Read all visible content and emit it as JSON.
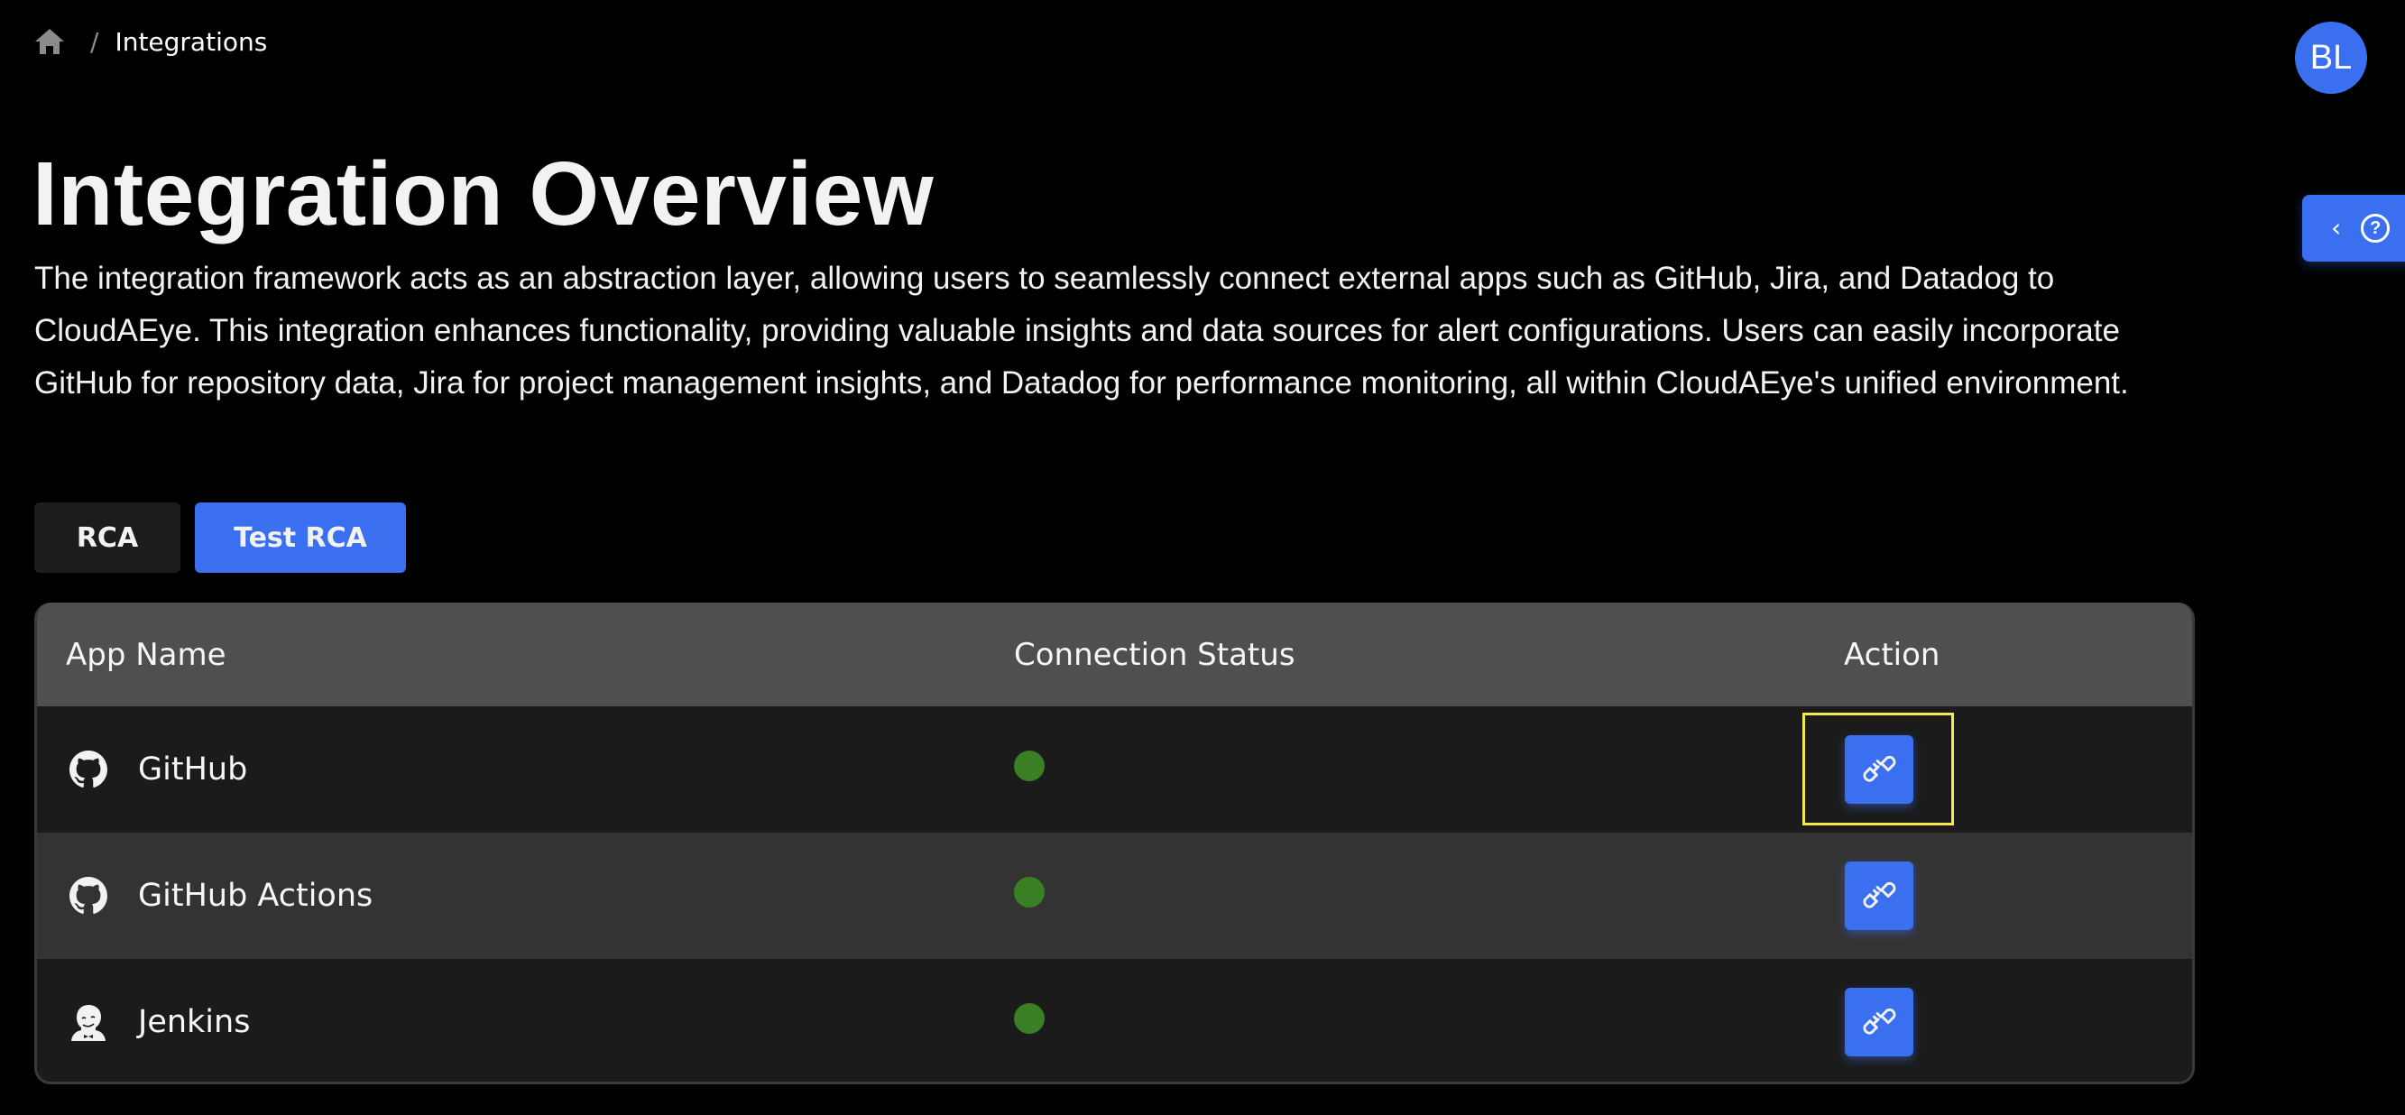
{
  "breadcrumb": {
    "home_icon": "home-icon",
    "separator": "/",
    "current": "Integrations"
  },
  "user": {
    "initials": "BL",
    "avatar_color": "#3a6ff0"
  },
  "help_tab": {
    "collapse_icon": "chevron-left-icon",
    "help_icon": "question-circle-icon",
    "chevron": "‹",
    "help_glyph": "?"
  },
  "page": {
    "title": "Integration Overview",
    "description": "The integration framework acts as an abstraction layer, allowing users to seamlessly connect external apps such as GitHub, Jira, and Datadog to CloudAEye. This integration enhances functionality, providing valuable insights and data sources for alert configurations. Users can easily incorporate GitHub for repository data, Jira for project management insights, and Datadog for performance monitoring, all within CloudAEye's unified environment."
  },
  "tabs": [
    {
      "label": "RCA",
      "active": false
    },
    {
      "label": "Test RCA",
      "active": true
    }
  ],
  "table": {
    "columns": [
      "App Name",
      "Connection Status",
      "Action"
    ],
    "rows": [
      {
        "app": "GitHub",
        "icon": "github-icon",
        "status": "connected",
        "status_color": "#3a7f24",
        "action_icon": "plug-connect-icon"
      },
      {
        "app": "GitHub Actions",
        "icon": "github-icon",
        "status": "connected",
        "status_color": "#3a7f24",
        "action_icon": "plug-connect-icon"
      },
      {
        "app": "Jenkins",
        "icon": "jenkins-icon",
        "status": "connected",
        "status_color": "#3a7f24",
        "action_icon": "plug-connect-icon"
      }
    ]
  },
  "colors": {
    "accent": "#3a6ff0",
    "header_bg": "#4f4f4f",
    "row_dark": "#1b1b1b",
    "row_light": "#333333",
    "status_connected": "#3a7f24",
    "focus_outline": "#f5e94a"
  }
}
